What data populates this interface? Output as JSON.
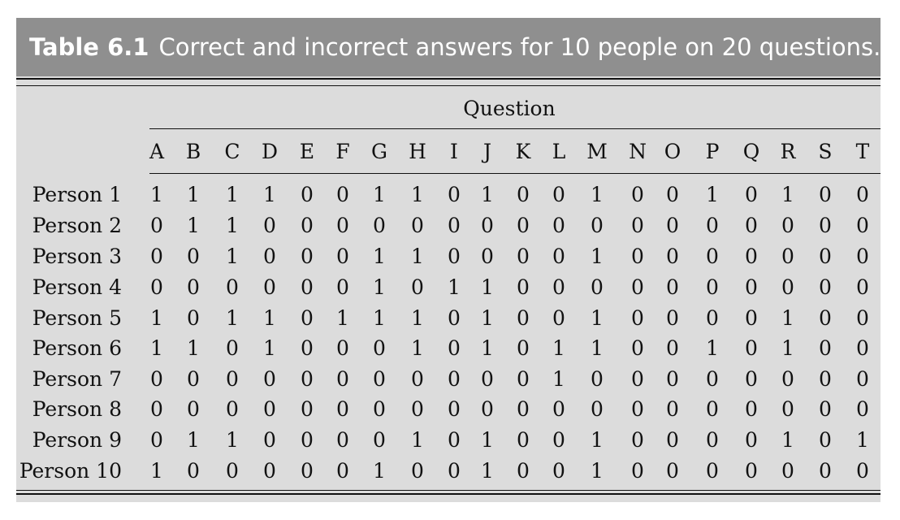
{
  "caption": {
    "label": "Table 6.1",
    "text": "Correct and incorrect answers for 10 people on 20 questions."
  },
  "table": {
    "group_header": "Question",
    "columns": [
      "A",
      "B",
      "C",
      "D",
      "E",
      "F",
      "G",
      "H",
      "I",
      "J",
      "K",
      "L",
      "M",
      "N",
      "O",
      "P",
      "Q",
      "R",
      "S",
      "T"
    ],
    "rows": [
      {
        "label": "Person 1",
        "values": [
          "1",
          "1",
          "1",
          "1",
          "0",
          "0",
          "1",
          "1",
          "0",
          "1",
          "0",
          "0",
          "1",
          "0",
          "0",
          "1",
          "0",
          "1",
          "0",
          "0"
        ]
      },
      {
        "label": "Person 2",
        "values": [
          "0",
          "1",
          "1",
          "0",
          "0",
          "0",
          "0",
          "0",
          "0",
          "0",
          "0",
          "0",
          "0",
          "0",
          "0",
          "0",
          "0",
          "0",
          "0",
          "0"
        ]
      },
      {
        "label": "Person 3",
        "values": [
          "0",
          "0",
          "1",
          "0",
          "0",
          "0",
          "1",
          "1",
          "0",
          "0",
          "0",
          "0",
          "1",
          "0",
          "0",
          "0",
          "0",
          "0",
          "0",
          "0"
        ]
      },
      {
        "label": "Person 4",
        "values": [
          "0",
          "0",
          "0",
          "0",
          "0",
          "0",
          "1",
          "0",
          "1",
          "1",
          "0",
          "0",
          "0",
          "0",
          "0",
          "0",
          "0",
          "0",
          "0",
          "0"
        ]
      },
      {
        "label": "Person 5",
        "values": [
          "1",
          "0",
          "1",
          "1",
          "0",
          "1",
          "1",
          "1",
          "0",
          "1",
          "0",
          "0",
          "1",
          "0",
          "0",
          "0",
          "0",
          "1",
          "0",
          "0"
        ]
      },
      {
        "label": "Person 6",
        "values": [
          "1",
          "1",
          "0",
          "1",
          "0",
          "0",
          "0",
          "1",
          "0",
          "1",
          "0",
          "1",
          "1",
          "0",
          "0",
          "1",
          "0",
          "1",
          "0",
          "0"
        ]
      },
      {
        "label": "Person 7",
        "values": [
          "0",
          "0",
          "0",
          "0",
          "0",
          "0",
          "0",
          "0",
          "0",
          "0",
          "0",
          "1",
          "0",
          "0",
          "0",
          "0",
          "0",
          "0",
          "0",
          "0"
        ]
      },
      {
        "label": "Person 8",
        "values": [
          "0",
          "0",
          "0",
          "0",
          "0",
          "0",
          "0",
          "0",
          "0",
          "0",
          "0",
          "0",
          "0",
          "0",
          "0",
          "0",
          "0",
          "0",
          "0",
          "0"
        ]
      },
      {
        "label": "Person 9",
        "values": [
          "0",
          "1",
          "1",
          "0",
          "0",
          "0",
          "0",
          "1",
          "0",
          "1",
          "0",
          "0",
          "1",
          "0",
          "0",
          "0",
          "0",
          "1",
          "0",
          "1"
        ]
      },
      {
        "label": "Person 10",
        "values": [
          "1",
          "0",
          "0",
          "0",
          "0",
          "0",
          "1",
          "0",
          "0",
          "1",
          "0",
          "0",
          "1",
          "0",
          "0",
          "0",
          "0",
          "0",
          "0",
          "0"
        ]
      }
    ]
  },
  "colors": {
    "caption_bg": "#8f8f8f",
    "caption_text": "#ffffff",
    "table_bg": "#dcdcdc",
    "rules": "#111111"
  }
}
